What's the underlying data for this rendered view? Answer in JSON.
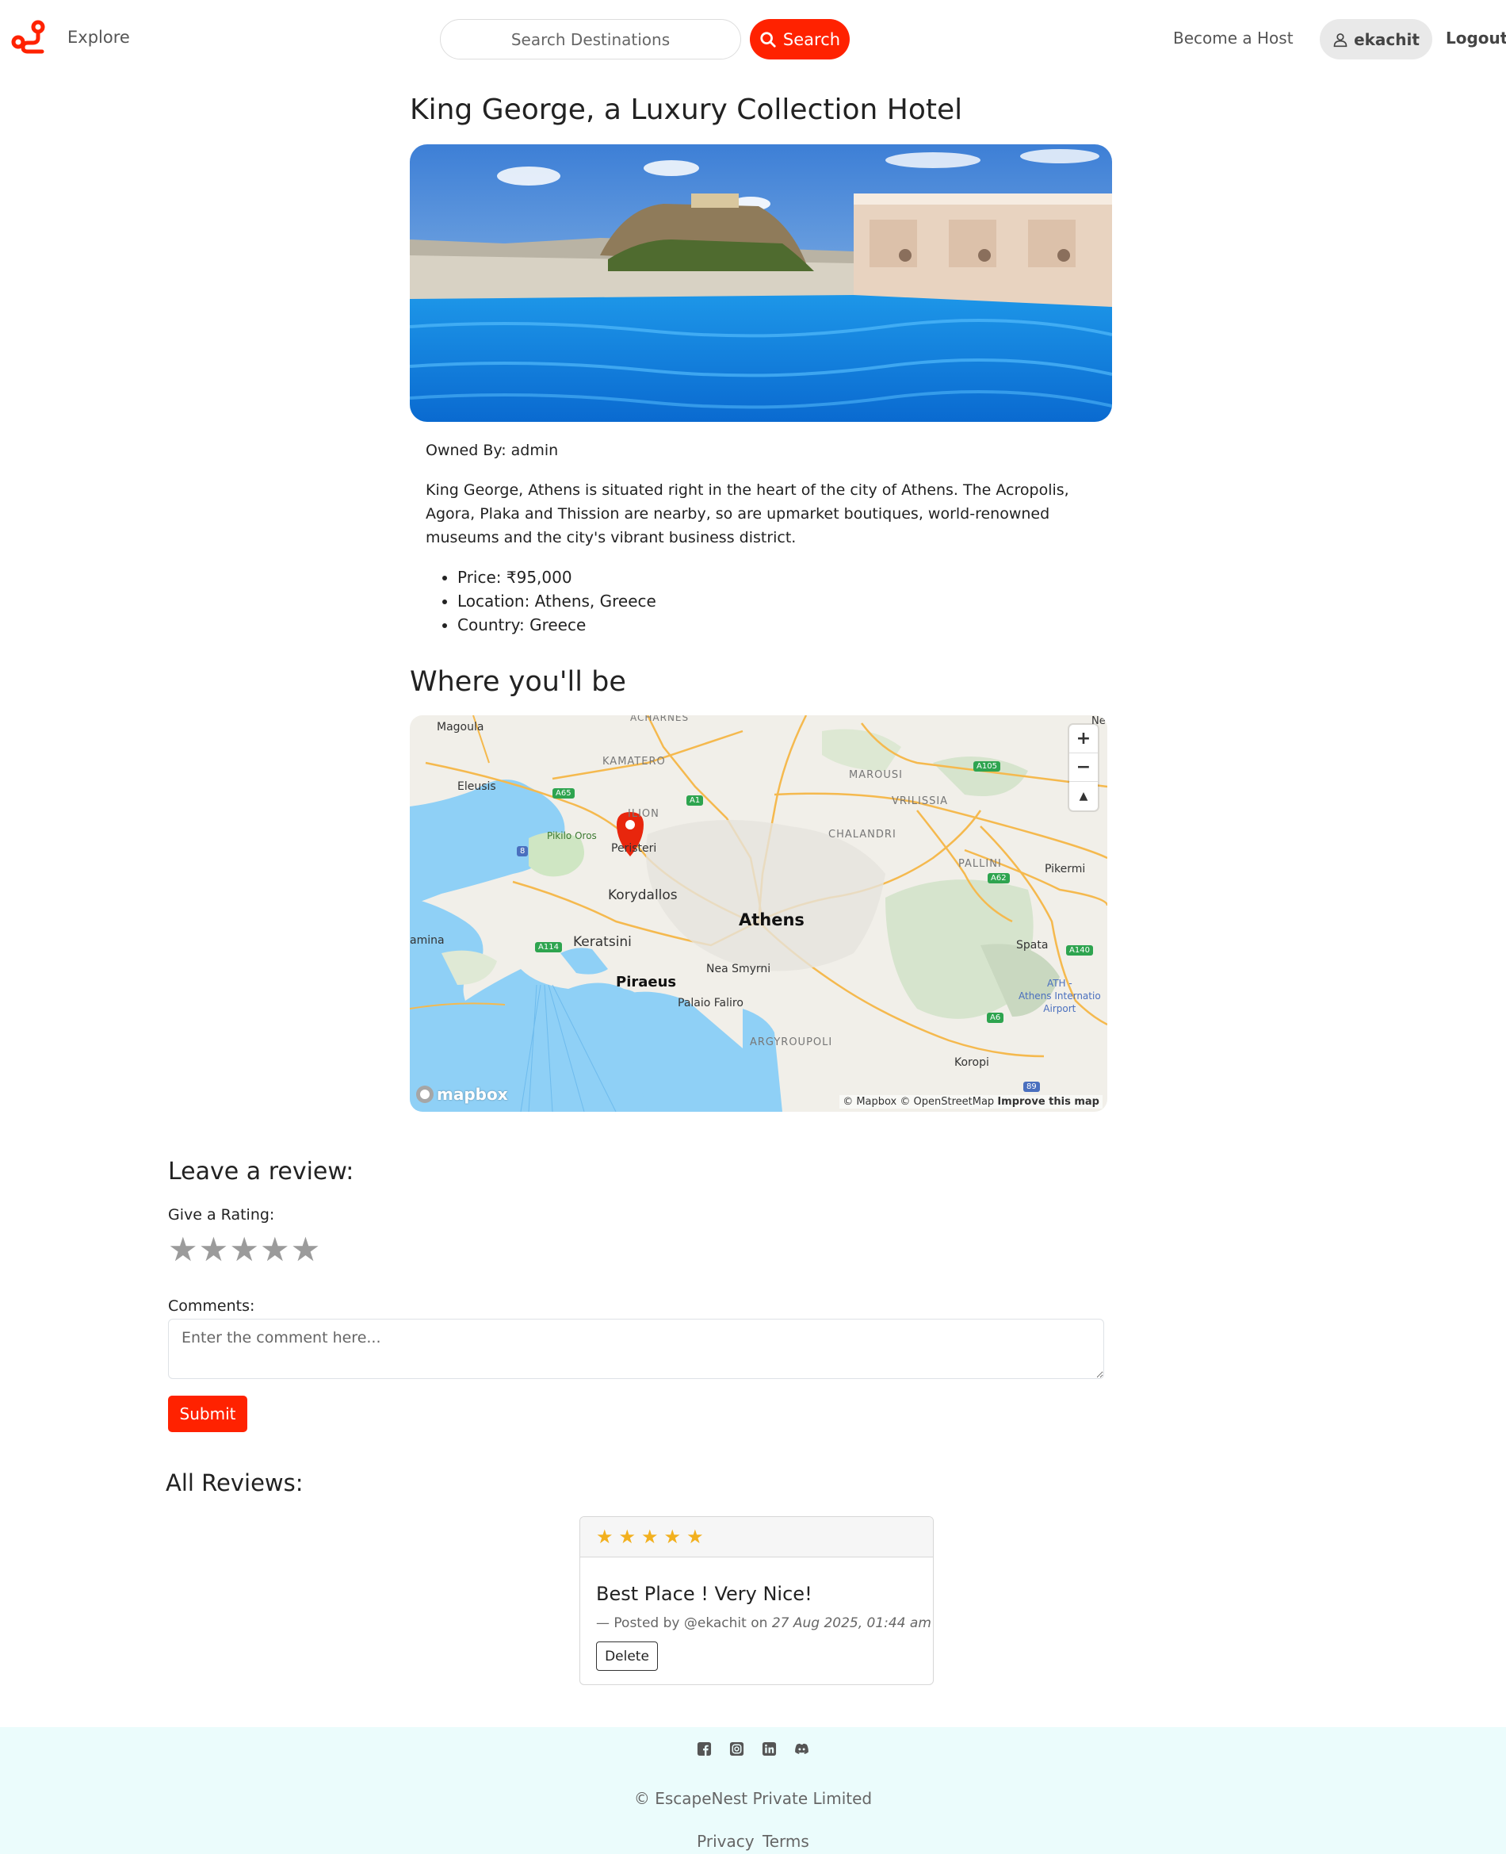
{
  "nav": {
    "explore": "Explore",
    "search_placeholder": "Search Destinations",
    "search_button": "Search",
    "become_host": "Become a Host",
    "username": "ekachit",
    "logout": "Logout",
    "brand_color": "#ff2200"
  },
  "listing": {
    "title": "King George, a Luxury Collection Hotel",
    "owned_by": "Owned By: admin",
    "description": "King George, Athens is situated right in the heart of the city of Athens. The Acropolis, Agora, Plaka and Thission are nearby, so are upmarket boutiques, world-renowned museums and the city's vibrant business district.",
    "facts": [
      "Price: ₹95,000",
      "Location: Athens, Greece",
      "Country: Greece"
    ]
  },
  "map": {
    "heading": "Where you'll be",
    "zoom_in": "+",
    "zoom_out": "−",
    "compass": "▲",
    "attribution": "© Mapbox © OpenStreetMap",
    "improve": "Improve this map",
    "mapbox_logo": "mapbox",
    "labels": {
      "acharnes": "ACHARNES",
      "magoula": "Magoula",
      "kamatero": "KAMATERO",
      "marousi": "MAROUSI",
      "a105": "A105",
      "eleusis": "Eleusis",
      "a65": "A65",
      "a1": "A1",
      "vrilissia": "VRILISSIA",
      "ilion": "ILION",
      "pikilo": "Pikilo Oros",
      "chalandri": "CHALANDRI",
      "r8": "8",
      "peristeri": "Peristeri",
      "pallini": "PALLINI",
      "pikermi": "Pikermi",
      "a62": "A62",
      "korydallos": "Korydallos",
      "athens": "Athens",
      "salamina": "amina",
      "a114": "A114",
      "keratsini": "Keratsini",
      "spata": "Spata",
      "a140": "A140",
      "piraeus": "Piraeus",
      "nea_smyrni": "Nea Smyrni",
      "palaio_faliro": "Palaio Faliro",
      "airport": "ATH -\nAthens Internatio\nAirport",
      "a6": "A6",
      "argyroupoli": "ARGYROUPOLI",
      "koropi": "Koropi",
      "r89": "89",
      "ne": "Ne"
    }
  },
  "review_form": {
    "heading": "Leave a review:",
    "rating_label": "Give a Rating:",
    "stars": [
      "★",
      "★",
      "★",
      "★",
      "★"
    ],
    "comments_label": "Comments:",
    "comment_placeholder": "Enter the comment here...",
    "submit": "Submit"
  },
  "reviews": {
    "heading": "All Reviews:",
    "items": [
      {
        "stars": [
          "★",
          "★",
          "★",
          "★",
          "★"
        ],
        "rating": 5,
        "comment": "Best Place ! Very Nice!",
        "posted_by": "— Posted by @ekachit on",
        "date": "27 Aug 2025, 01:44 am",
        "delete": "Delete"
      }
    ]
  },
  "footer": {
    "socials": [
      "facebook-icon",
      "instagram-icon",
      "linkedin-icon",
      "discord-icon"
    ],
    "copyright": "© EscapeNest Private Limited",
    "privacy": "Privacy",
    "terms": "Terms"
  }
}
